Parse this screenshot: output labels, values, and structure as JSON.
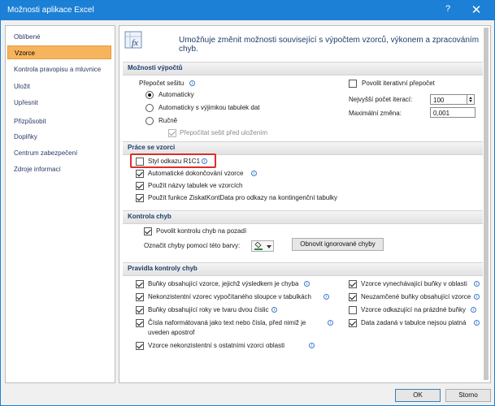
{
  "window": {
    "title": "Možnosti aplikace Excel",
    "help": "?",
    "close": "✕"
  },
  "sidebar": {
    "items": [
      {
        "label": "Oblíbené",
        "selected": false
      },
      {
        "label": "Vzorce",
        "selected": true
      },
      {
        "label": "Kontrola pravopisu a mluvnice",
        "selected": false
      },
      {
        "label": "Uložit",
        "selected": false
      },
      {
        "label": "Upřesnit",
        "selected": false
      },
      {
        "label": "Přizpůsobit",
        "selected": false
      },
      {
        "label": "Doplňky",
        "selected": false
      },
      {
        "label": "Centrum zabezpečení",
        "selected": false
      },
      {
        "label": "Zdroje informací",
        "selected": false
      }
    ]
  },
  "header": {
    "icon": "fx-formula-icon",
    "text": "Umožňuje změnit možnosti související s výpočtem vzorců, výkonem a zpracováním chyb."
  },
  "calc": {
    "section": "Možnosti výpočtů",
    "workbook_label": "Přepočet sešitu",
    "radios": [
      {
        "label": "Automaticky",
        "selected": true
      },
      {
        "label": "Automaticky s výjimkou tabulek dat",
        "selected": false
      },
      {
        "label": "Ručně",
        "selected": false
      }
    ],
    "recalc_before_save": {
      "label": "Přepočítat sešit před uložením",
      "checked": true,
      "disabled": true
    },
    "iterative": {
      "label": "Povolit iterativní přepočet",
      "checked": false
    },
    "max_iterations": {
      "label": "Nejvyšší počet iterací:",
      "value": "100"
    },
    "max_change": {
      "label": "Maximální změna:",
      "value": "0,001"
    }
  },
  "formulas": {
    "section": "Práce se vzorci",
    "items": [
      {
        "label": "Styl odkazu R1C1",
        "checked": false,
        "info": true
      },
      {
        "label": "Automatické dokončování vzorce",
        "checked": true,
        "info": true
      },
      {
        "label": "Použít názvy tabulek ve vzorcích",
        "checked": true,
        "info": false
      },
      {
        "label": "Použít funkce ZiskatKontData pro odkazy na kontingenční tabulky",
        "checked": true,
        "info": false
      }
    ]
  },
  "errors": {
    "section": "Kontrola chyb",
    "background": {
      "label": "Povolit kontrolu chyb na pozadí",
      "checked": true
    },
    "color_label": "Označit chyby pomocí této barvy:",
    "reset_button": "Obnovit ignorované chyby",
    "accent_color": "#2e8b2e"
  },
  "rules": {
    "section": "Pravidla kontroly chyb",
    "left": [
      {
        "label": "Buňky obsahující vzorce, jejichž výsledkem je chyba",
        "checked": true
      },
      {
        "label": "Nekonzistentní vzorec vypočítaného sloupce v tabulkách",
        "checked": true
      },
      {
        "label": "Buňky obsahující roky ve tvaru dvou číslic",
        "checked": true
      },
      {
        "label": "Čísla naformátovaná jako text nebo čísla, před nimiž je",
        "label2": "uveden apostrof",
        "checked": true
      },
      {
        "label": "Vzorce nekonzistentní s ostatními vzorci oblasti",
        "checked": true
      }
    ],
    "right": [
      {
        "label": "Vzorce vynechávající buňky v oblasti",
        "checked": true
      },
      {
        "label": "Neuzamčené buňky obsahující vzorce",
        "checked": true
      },
      {
        "label": "Vzorce odkazující na prázdné buňky",
        "checked": false
      },
      {
        "label": "Data zadaná v tabulce nejsou platná",
        "checked": true
      }
    ]
  },
  "footer": {
    "ok": "OK",
    "cancel": "Storno"
  },
  "info_glyph": "i"
}
